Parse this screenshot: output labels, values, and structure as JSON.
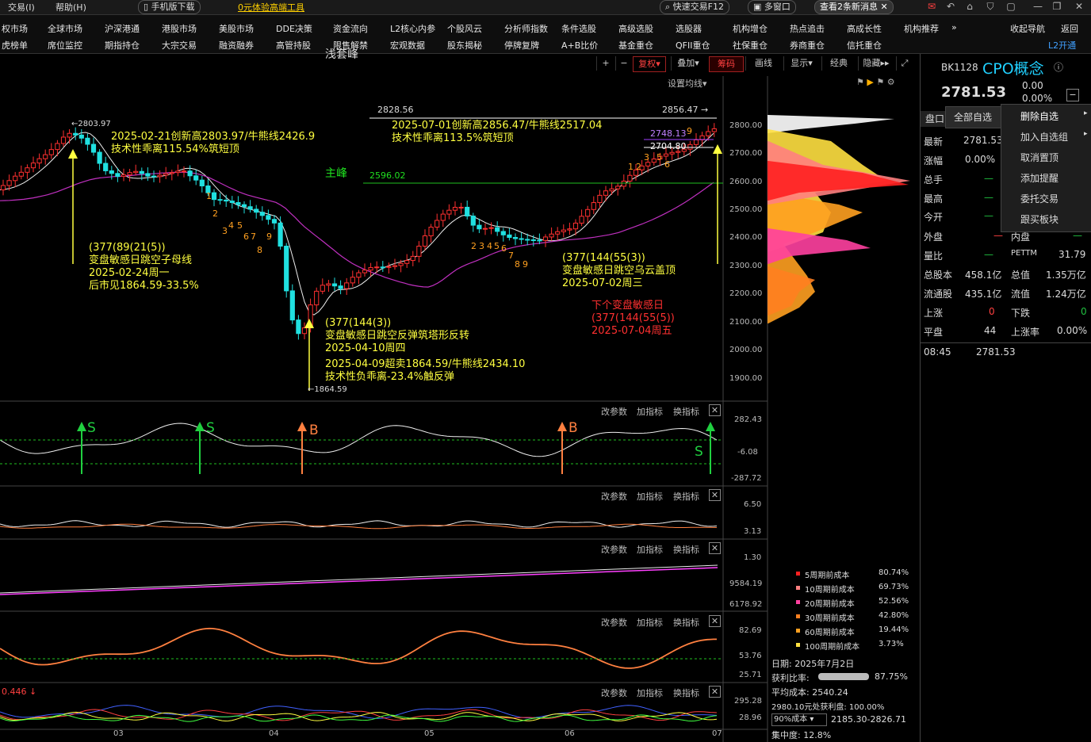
{
  "topbar": {
    "menu": [
      "交易(I)",
      "帮助(H)"
    ],
    "mobile_download": "手机版下载",
    "promo": "0元体验高端工具",
    "quick_trade": "快速交易F12",
    "multi_window": "多窗口",
    "messages": "查看2条新消息"
  },
  "menu_row1": [
    "权市场",
    "全球市场",
    "沪深港通",
    "港股市场",
    "美股市场",
    "DDE决策",
    "资金流向",
    "L2核心内参",
    "个股风云",
    "分析师指数",
    "条件选股",
    "高级选股",
    "选股器",
    "机构增仓",
    "热点追击",
    "高成长性",
    "机构推荐",
    "收起导航",
    "返回"
  ],
  "menu_row2": [
    "虎榜单",
    "席位监控",
    "期指持仓",
    "大宗交易",
    "融资融券",
    "高管持股",
    "限售解禁",
    "宏观数据",
    "股东揭秘",
    "停牌复牌",
    "A+B比价",
    "基金重仓",
    "QFII重仓",
    "社保重仓",
    "券商重仓",
    "信托重仓",
    "L2开通"
  ],
  "chart_toolbar": [
    "+",
    "−",
    "复权",
    "叠加",
    "筹码",
    "画线",
    "显示",
    "经典",
    "隐藏"
  ],
  "settings_ma": "设置均线",
  "main_chart": {
    "labels": {
      "qiantao": "浅套峰",
      "zhufeng": "主峰",
      "qiantao_price": "2828.56",
      "zhufeng_price": "2596.02",
      "high_mark_1": "2803.97",
      "high_mark_2": "2856.47",
      "low_mark": "1864.59",
      "m1": "2748.13",
      "m2": "2704.80",
      "ann1_l1": "2025-02-21创新高2803.97/牛熊线2426.9",
      "ann1_l2": "技术性乖离115.54%筑短顶",
      "ann2_l1": "2025-07-01创新高2856.47/牛熊线2517.04",
      "ann2_l2": "技术性乖离113.5%筑短顶",
      "ann3_l1": "(377(89(21(5))",
      "ann3_l2": "变盘敏感日跳空子母线",
      "ann3_l3": "2025-02-24周一",
      "ann3_l4": "后市见1864.59-33.5%",
      "ann4_l1": "(377(144(3))",
      "ann4_l2": "变盘敏感日跳空反弹筑塔形反转",
      "ann4_l3": "2025-04-10周四",
      "ann5_l1": "2025-04-09超卖1864.59/牛熊线2434.10",
      "ann5_l2": "技术性负乖离-23.4%触反弹",
      "ann6_l1": "(377(144(55(3))",
      "ann6_l2": "变盘敏感日跳空乌云盖顶",
      "ann6_l3": "2025-07-02周三",
      "ann7_l1": "下个变盘敏感日",
      "ann7_l2": "(377(144(55(5))",
      "ann7_l3": "2025-07-04周五"
    },
    "y_ticks": [
      "2800.00",
      "2700.00",
      "2600.00",
      "2500.00",
      "2400.00",
      "2300.00",
      "2200.00",
      "2100.00",
      "2000.00",
      "1900.00"
    ],
    "x_ticks": [
      "03",
      "04",
      "05",
      "06",
      "07"
    ],
    "td_counts_1": [
      "1",
      "2",
      "3",
      "4",
      "5",
      "6",
      "7",
      "8",
      "9"
    ],
    "td_counts_2": [
      "2",
      "3",
      "4",
      "5",
      "6",
      "7",
      "8",
      "9"
    ],
    "td_counts_3": [
      "1",
      "2",
      "3",
      "5",
      "6",
      "9"
    ]
  },
  "panel_buttons": [
    "改参数",
    "加指标",
    "换指标"
  ],
  "sub_panels": [
    {
      "ticks": [
        "282.43",
        "-6.08",
        "-287.72"
      ],
      "signals": [
        "S",
        "S",
        "B",
        "B",
        "S"
      ]
    },
    {
      "ticks": [
        "6.50",
        "3.13"
      ]
    },
    {
      "ticks": [
        "1.30",
        "9584.19",
        "6178.92"
      ]
    },
    {
      "ticks": [
        "82.69",
        "53.76",
        "25.71"
      ]
    },
    {
      "ticks": [
        "295.28",
        "28.96"
      ],
      "readout": "0.446"
    }
  ],
  "chip_costs": [
    {
      "label": "5周期前成本",
      "value": "80.74%",
      "color": "#ff2020"
    },
    {
      "label": "10周期前成本",
      "value": "69.73%",
      "color": "#ff8080"
    },
    {
      "label": "20周期前成本",
      "value": "52.56%",
      "color": "#ff40a0"
    },
    {
      "label": "30周期前成本",
      "value": "42.80%",
      "color": "#ff8020"
    },
    {
      "label": "60周期前成本",
      "value": "19.44%",
      "color": "#ffa020"
    },
    {
      "label": "100周期前成本",
      "value": "3.73%",
      "color": "#ffe040"
    }
  ],
  "chip_info": {
    "date": "日期: 2025年7月2日",
    "profit_label": "获利比率:",
    "profit_value": "87.75%",
    "avg_cost": "平均成本: 2540.24",
    "profit_at": "2980.10元处获利盘: 100.00%",
    "cost_select": "90%成本",
    "cost_range": "2185.30-2826.71",
    "concentration": "集中度: 12.8%"
  },
  "right_panel": {
    "code": "BK1128",
    "name": "CPO概念",
    "price": "2781.53",
    "change": "0.00",
    "change_pct": "0.00%",
    "tab": "盘口",
    "rows": [
      {
        "label": "最新",
        "value": "2781.53"
      },
      {
        "label": "涨幅",
        "value": "0.00%"
      },
      {
        "label": "总手",
        "value": "—"
      },
      {
        "label": "最高",
        "value": "—"
      },
      {
        "label": "今开",
        "value": "—"
      }
    ],
    "outer": "外盘",
    "outer_v": "—",
    "inner": "内盘",
    "inner_v": "—",
    "ratio": "量比",
    "ratio_v": "—",
    "pe": "PETTM",
    "pe_v": "31.79",
    "total_shares": "总股本",
    "total_shares_v": "458.1亿",
    "total_value": "总值",
    "total_value_v": "1.35万亿",
    "float_shares": "流通股",
    "float_shares_v": "435.1亿",
    "float_value": "流值",
    "float_value_v": "1.24万亿",
    "up": "上涨",
    "up_v": "0",
    "down": "下跌",
    "down_v": "0",
    "flat": "平盘",
    "flat_v": "44",
    "up_rate": "上涨率",
    "up_rate_v": "0.00%",
    "tick_time": "08:45",
    "tick_price": "2781.53"
  },
  "context_menu": {
    "all": "全部自选",
    "items": [
      "删除自选",
      "加入自选组",
      "取消置顶",
      "添加提醒",
      "委托交易",
      "跟买板块"
    ]
  }
}
